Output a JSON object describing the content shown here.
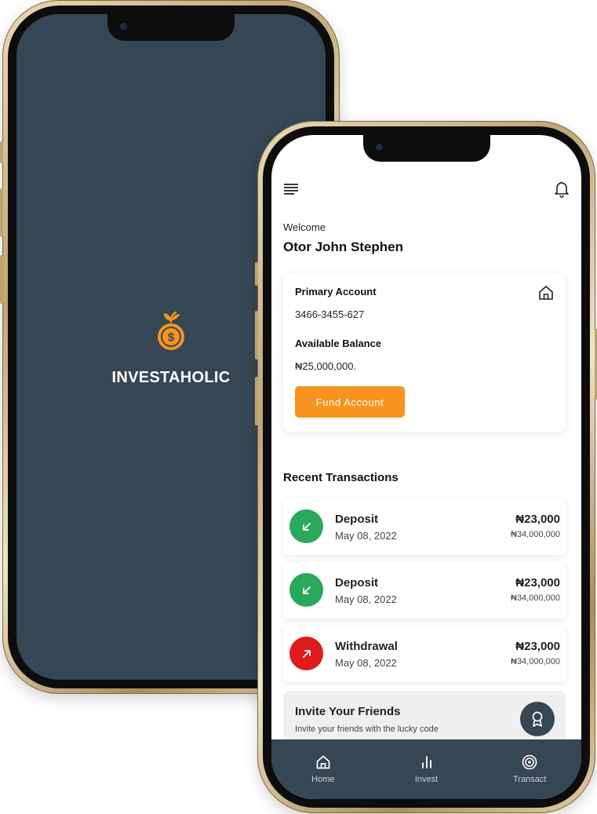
{
  "splash": {
    "brand": "INVESTAHOLIC"
  },
  "header": {
    "welcome": "Welcome",
    "user_name": "Otor John Stephen"
  },
  "account": {
    "primary_label": "Primary Account",
    "account_number": "3466-3455-627",
    "balance_label": "Available Balance",
    "balance": "₦25,000,000.",
    "fund_button": "Fund Account"
  },
  "transactions": {
    "title": "Recent Transactions",
    "items": [
      {
        "type": "Deposit",
        "date": "May 08, 2022",
        "amount": "₦23,000",
        "balance": "₦34,000,000",
        "direction": "in",
        "color": "#2aa85c"
      },
      {
        "type": "Deposit",
        "date": "May 08, 2022",
        "amount": "₦23,000",
        "balance": "₦34,000,000",
        "direction": "in",
        "color": "#2aa85c"
      },
      {
        "type": "Withdrawal",
        "date": "May 08, 2022",
        "amount": "₦23,000",
        "balance": "₦34,000,000",
        "direction": "out",
        "color": "#e01b1b"
      }
    ]
  },
  "invite": {
    "title": "Invite Your Friends",
    "subtitle": "Invite your friends with the lucky code"
  },
  "nav": {
    "items": [
      {
        "label": "Home",
        "icon": "home-icon"
      },
      {
        "label": "Invest",
        "icon": "bar-chart-icon"
      },
      {
        "label": "Transact",
        "icon": "target-icon"
      }
    ]
  },
  "colors": {
    "primary_dark": "#354654",
    "accent": "#f7931e",
    "deposit": "#2aa85c",
    "withdrawal": "#e01b1b"
  }
}
